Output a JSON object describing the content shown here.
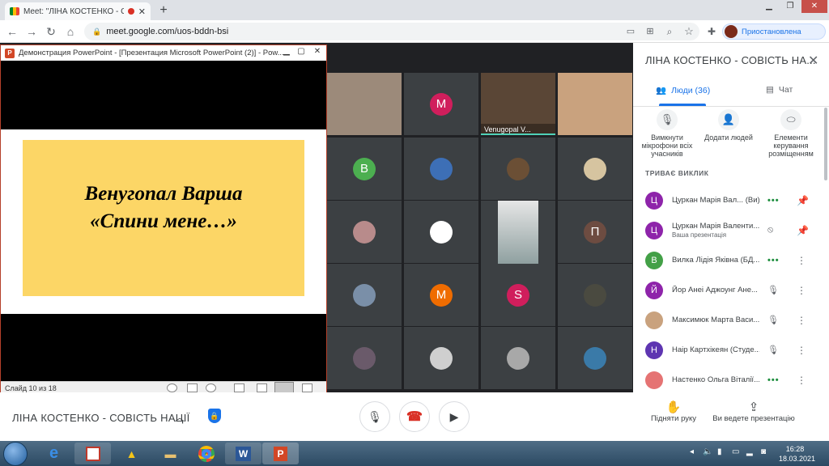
{
  "browser": {
    "tab_title": "Meet: \"ЛІНА КОСТЕНКО - СО",
    "url": "meet.google.com/uos-bddn-bsi",
    "profile_label": "Приостановлена"
  },
  "ppt": {
    "window_title": "Демонстрация PowerPoint - [Презентация Microsoft PowerPoint (2)] - Pow...",
    "slide_line1": "Венугопал Варша",
    "slide_line2": "«Спини мене…»",
    "status": "Слайд 10 из 18"
  },
  "grid": {
    "featured_name": "Venugopal V...",
    "tiles": [
      {
        "kind": "photo",
        "color": "#9c8a7a"
      },
      {
        "kind": "letter",
        "letter": "M",
        "color": "#d01e5c"
      },
      {
        "kind": "photo",
        "color": "#5a4636"
      },
      {
        "kind": "photo",
        "color": "#c9a27e"
      },
      {
        "kind": "letter",
        "letter": "B",
        "color": "#4caf50"
      },
      {
        "kind": "photo",
        "color": "#3d6fb6"
      },
      {
        "kind": "photo",
        "color": "#6b4f35"
      },
      {
        "kind": "photo",
        "color": "#d6c4a0"
      },
      {
        "kind": "photo",
        "color": "#b88b8b"
      },
      {
        "kind": "photo",
        "color": "#ffffff"
      },
      {
        "kind": "photo",
        "color": "#8fa0a0"
      },
      {
        "kind": "letter",
        "letter": "П",
        "color": "#6d4c41"
      },
      {
        "kind": "photo",
        "color": "#7a8fa8"
      },
      {
        "kind": "letter",
        "letter": "M",
        "color": "#ef6c00"
      },
      {
        "kind": "letter",
        "letter": "S",
        "color": "#d01e5c"
      },
      {
        "kind": "photo",
        "color": "#4a4a40"
      },
      {
        "kind": "photo",
        "color": "#6a5a6a"
      },
      {
        "kind": "photo",
        "color": "#cfcfcf"
      },
      {
        "kind": "photo",
        "color": "#a8a8a8"
      },
      {
        "kind": "photo",
        "color": "#3a7aa8"
      }
    ]
  },
  "panel": {
    "title": "ЛІНА КОСТЕНКО - СОВІСТЬ НА...",
    "tab_people": "Люди (36)",
    "tab_chat": "Чат",
    "action_mute": "Вимкнути мікрофони всіх учасників",
    "action_add": "Додати людей",
    "action_controls": "Елементи керування розміщенням",
    "section_label": "ТРИВАЄ ВИКЛИК",
    "participants": [
      {
        "initial": "Ц",
        "color": "#8e24aa",
        "name": "Цуркан Марія Вал... (Ви)",
        "sub": "",
        "icon1": "•••",
        "icon2": "📌"
      },
      {
        "initial": "Ц",
        "color": "#8e24aa",
        "name": "Цуркан Марія Валенти...",
        "sub": "Ваша презентація",
        "icon1": "⦸",
        "icon2": "📌"
      },
      {
        "initial": "В",
        "color": "#43a047",
        "name": "Вилка Лідія Яківна (БД...",
        "sub": "",
        "icon1": "•••",
        "icon2": "⋮"
      },
      {
        "initial": "Й",
        "color": "#8e24aa",
        "name": "Йор Анеі Аджоунг Ане...",
        "sub": "",
        "icon1": "🎙",
        "icon2": "⋮"
      },
      {
        "initial": "",
        "color": "#c9a27e",
        "name": "Максимюк Марта Васи...",
        "sub": "",
        "icon1": "🎙",
        "icon2": "⋮"
      },
      {
        "initial": "Н",
        "color": "#5e35b1",
        "name": "Наір Картхікеян (Студе...",
        "sub": "",
        "icon1": "🎙",
        "icon2": "⋮"
      },
      {
        "initial": "",
        "color": "#e57373",
        "name": "Настенко Ольга Віталії...",
        "sub": "",
        "icon1": "•••",
        "icon2": "⋮"
      }
    ]
  },
  "bottom": {
    "meeting_name": "ЛІНА КОСТЕНКО - СОВІСТЬ НАЦІЇ",
    "raise_hand": "Підняти руку",
    "presenting": "Ви ведете презентацію"
  },
  "taskbar": {
    "time": "16:28",
    "date": "18.03.2021"
  }
}
